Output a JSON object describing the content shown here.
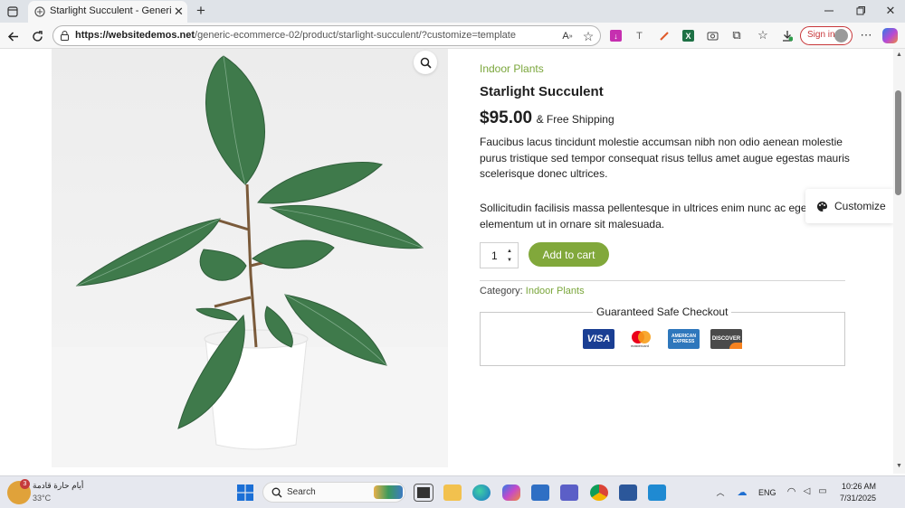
{
  "browser": {
    "tab_title": "Starlight Succulent - Generic eCommerce",
    "url_domain": "https://websitedemos.net",
    "url_path": "/generic-ecommerce-02/product/starlight-succulent/?customize=template",
    "signin_label": "Sign in",
    "new_tab": "+"
  },
  "product": {
    "category_top": "Indoor Plants",
    "name": "Starlight Succulent",
    "price": "$95.00",
    "shipping": "& Free Shipping",
    "desc1": "Faucibus lacus tincidunt molestie accumsan nibh non odio aenean molestie purus tristique sed tempor consequat risus tellus amet augue egestas mauris scelerisque donec ultrices.",
    "desc2": "Sollicitudin facilisis massa pellentesque in ultrices enim nunc ac eget elementum ut in ornare sit malesuada.",
    "qty": "1",
    "add_to_cart": "Add to cart",
    "category_label": "Category:",
    "category_value": "Indoor Plants",
    "checkout_title": "Guaranteed Safe Checkout",
    "cards": [
      "VISA",
      "mastercard",
      "AMERICAN EXPRESS",
      "DISCOVER"
    ]
  },
  "customize_label": "Customize",
  "taskbar": {
    "weather_text": "أيام حارة قادمة",
    "weather_temp": "33°C",
    "weather_badge": "3",
    "search_label": "Search",
    "lang": "ENG",
    "time": "10:26 AM",
    "date": "7/31/2025"
  },
  "colors": {
    "accent": "#7aa63b",
    "button": "#81a83b",
    "text": "#1f1f1f"
  }
}
